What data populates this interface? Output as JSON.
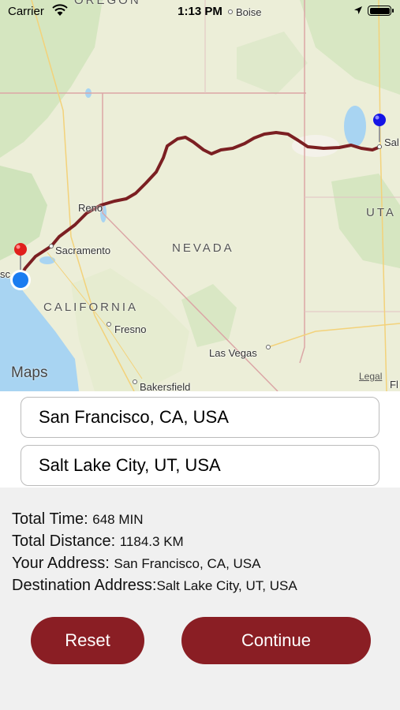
{
  "status": {
    "carrier": "Carrier",
    "time": "1:13 PM"
  },
  "map": {
    "labels": {
      "oregon": "OREGON",
      "boise": "Boise",
      "nevada": "NEVADA",
      "california": "CALIFORNIA",
      "utah": "UTA",
      "sacramento": "Sacramento",
      "reno": "Reno",
      "fresno": "Fresno",
      "las_vegas": "Las Vegas",
      "bakersfield": "Bakersfield",
      "salt": "Sal",
      "sf_partial": "sc",
      "fl_partial": "Fl"
    },
    "attribution": "Maps",
    "legal": "Legal",
    "route_color": "#7b1f22",
    "origin_pin_color": "#e0201c",
    "destination_pin_color": "#1414e6",
    "user_location_color": "#1a7cf0"
  },
  "form": {
    "origin": "San Francisco, CA, USA",
    "destination": "Salt Lake City, UT, USA"
  },
  "info": {
    "time_label": "Total Time:",
    "time_value": "648 MIN",
    "distance_label": "Total Distance:",
    "distance_value": "1184.3 KM",
    "address_label": "Your Address:",
    "address_value": "San Francisco, CA, USA",
    "dest_label": "Destination Address:",
    "dest_value": "Salt Lake City, UT, USA"
  },
  "buttons": {
    "reset": "Reset",
    "continue": "Continue"
  },
  "colors": {
    "accent": "#8a1e24"
  }
}
